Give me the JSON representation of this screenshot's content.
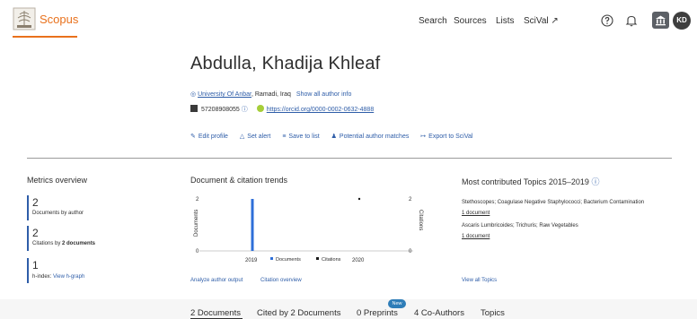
{
  "header": {
    "brand": "Scopus",
    "nav": [
      "Search",
      "Sources",
      "Lists",
      "SciVal ↗"
    ],
    "avatar_initials": "KD",
    "brand_color": "#e9711c"
  },
  "profile": {
    "name": "Abdulla, Khadija Khleaf",
    "affiliation": "University Of Anbar",
    "location": ", Ramadi, Iraq",
    "show_all_info": "Show all author info",
    "author_id": "57208908055",
    "orcid_url": "https://orcid.org/0000-0002-0632-4888",
    "actions": [
      "Edit profile",
      "Set alert",
      "Save to list",
      "Potential author matches",
      "Export to SciVal"
    ]
  },
  "metrics": {
    "title": "Metrics overview",
    "documents": {
      "value": "2",
      "label": "Documents by author"
    },
    "citations": {
      "value": "2",
      "label_prefix": "Citations by ",
      "label_bold": "2 documents"
    },
    "h_index": {
      "value": "1",
      "label": "h-index:",
      "link": "View h-graph"
    }
  },
  "trends": {
    "title": "Document & citation trends",
    "analyze_link": "Analyze author output",
    "citation_link": "Citation overview"
  },
  "chart_data": {
    "type": "bar",
    "x": [
      "2019",
      "2020"
    ],
    "series": [
      {
        "name": "Documents",
        "type": "bar",
        "values": [
          2,
          0
        ],
        "color": "#2e6fd8"
      },
      {
        "name": "Citations",
        "type": "scatter",
        "values": [
          0,
          2
        ],
        "color": "#1a1a1a"
      }
    ],
    "ylabel_left": "Documents",
    "ylabel_right": "Citations",
    "ylim_left": [
      0,
      2
    ],
    "ylim_right": [
      0,
      2
    ],
    "yticks_left": [
      "2",
      "1",
      "0"
    ],
    "yticks_right": [
      "2",
      "1",
      "0"
    ],
    "legend": [
      "Documents",
      "Citations"
    ]
  },
  "topics": {
    "title": "Most contributed Topics 2015–2019",
    "items": [
      {
        "name": "Stethoscopes; Coagulase Negative Staphylococci; Bacterium Contamination",
        "count": "1 document"
      },
      {
        "name": "Ascaris Lumbricoides; Trichuris; Raw Vegetables",
        "count": "1 document"
      }
    ],
    "view_all": "View all Topics"
  },
  "tabs": {
    "items": [
      "2 Documents",
      "Cited by 2 Documents",
      "0 Preprints",
      "4 Co-Authors",
      "Topics"
    ],
    "new_badge": "New"
  }
}
